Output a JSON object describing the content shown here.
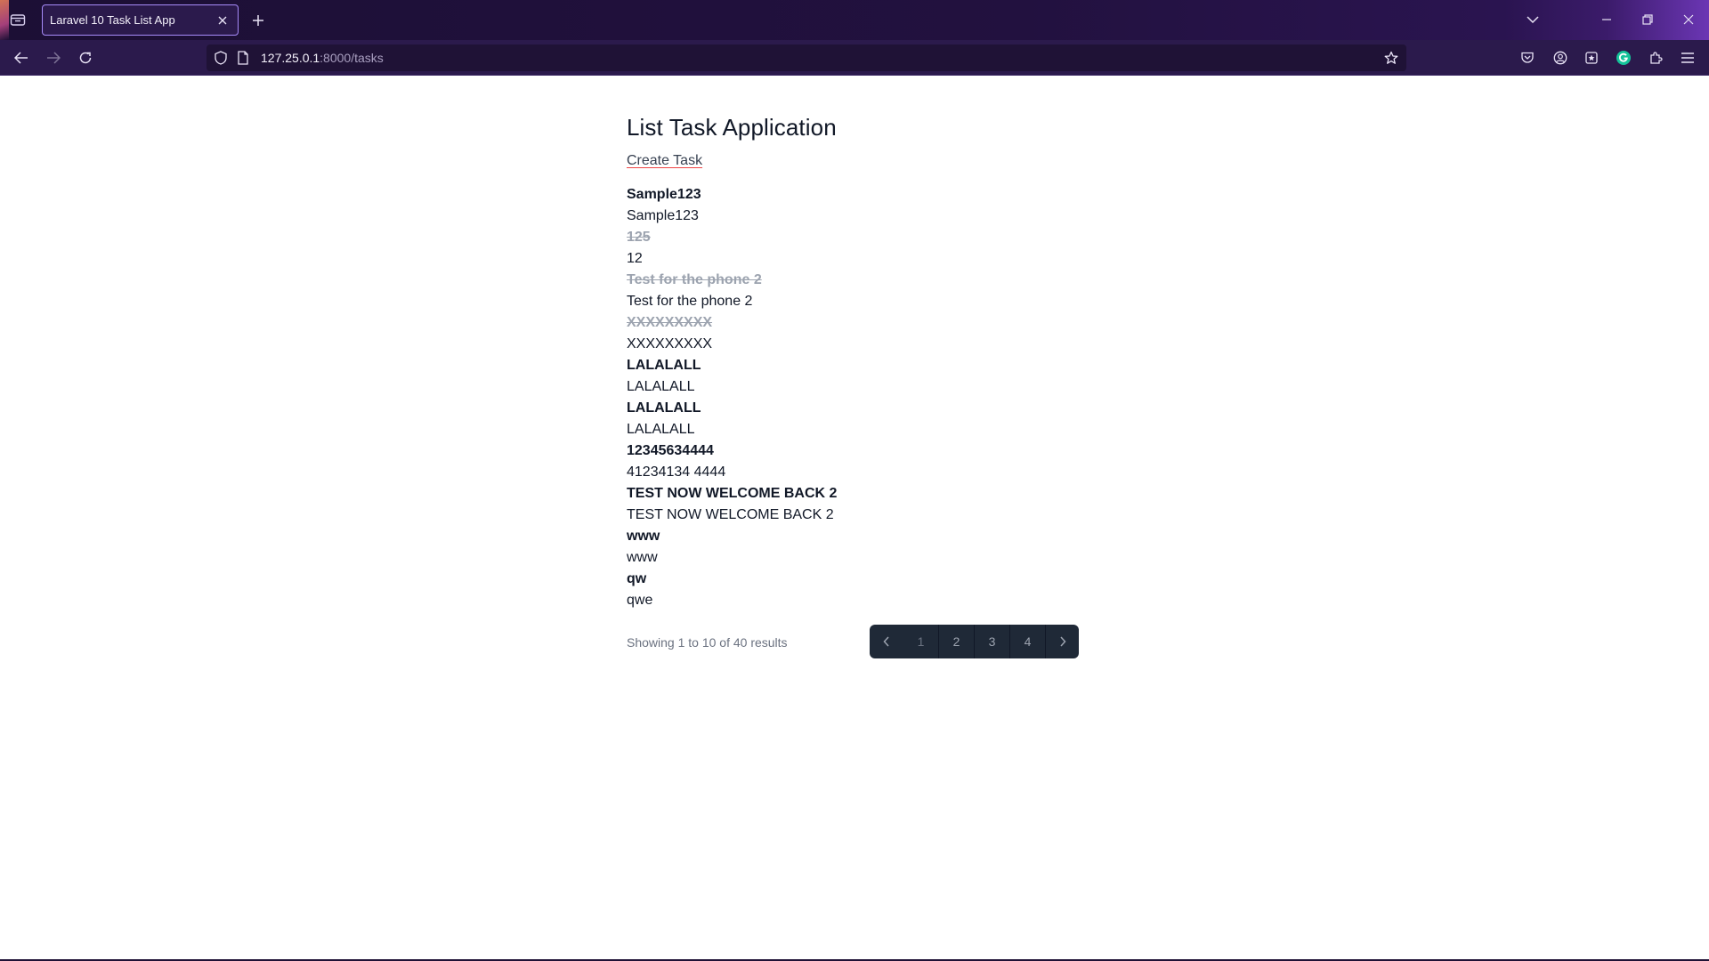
{
  "browser": {
    "tab_title": "Laravel 10 Task List App",
    "url_host": "127.25.0.1",
    "url_path": ":8000/tasks"
  },
  "page": {
    "title": "List Task Application",
    "create_link": "Create Task"
  },
  "tasks": [
    {
      "text": "Sample123",
      "style": "bold"
    },
    {
      "text": "Sample123",
      "style": "normal"
    },
    {
      "text": "125",
      "style": "done"
    },
    {
      "text": "12",
      "style": "normal"
    },
    {
      "text": "Test for the phone 2",
      "style": "done"
    },
    {
      "text": "Test for the phone 2",
      "style": "normal"
    },
    {
      "text": "XXXXXXXXX",
      "style": "done"
    },
    {
      "text": "XXXXXXXXX",
      "style": "normal"
    },
    {
      "text": "LALALALL",
      "style": "bold"
    },
    {
      "text": "LALALALL",
      "style": "normal"
    },
    {
      "text": "LALALALL",
      "style": "bold"
    },
    {
      "text": "LALALALL",
      "style": "normal"
    },
    {
      "text": "12345634444",
      "style": "bold"
    },
    {
      "text": "41234134 4444",
      "style": "normal"
    },
    {
      "text": "TEST NOW WELCOME BACK 2",
      "style": "bold"
    },
    {
      "text": "TEST NOW WELCOME BACK 2",
      "style": "normal"
    },
    {
      "text": "www",
      "style": "bold"
    },
    {
      "text": "www",
      "style": "normal"
    },
    {
      "text": "qw",
      "style": "bold"
    },
    {
      "text": "qwe",
      "style": "normal"
    }
  ],
  "pagination": {
    "summary": "Showing 1 to 10 of 40 results",
    "pages": [
      "1",
      "2",
      "3",
      "4"
    ],
    "current": "1"
  },
  "colors": {
    "accent_underline": "#ef4444",
    "done_text": "#9ca3af",
    "pager_bg": "#1f2937"
  }
}
